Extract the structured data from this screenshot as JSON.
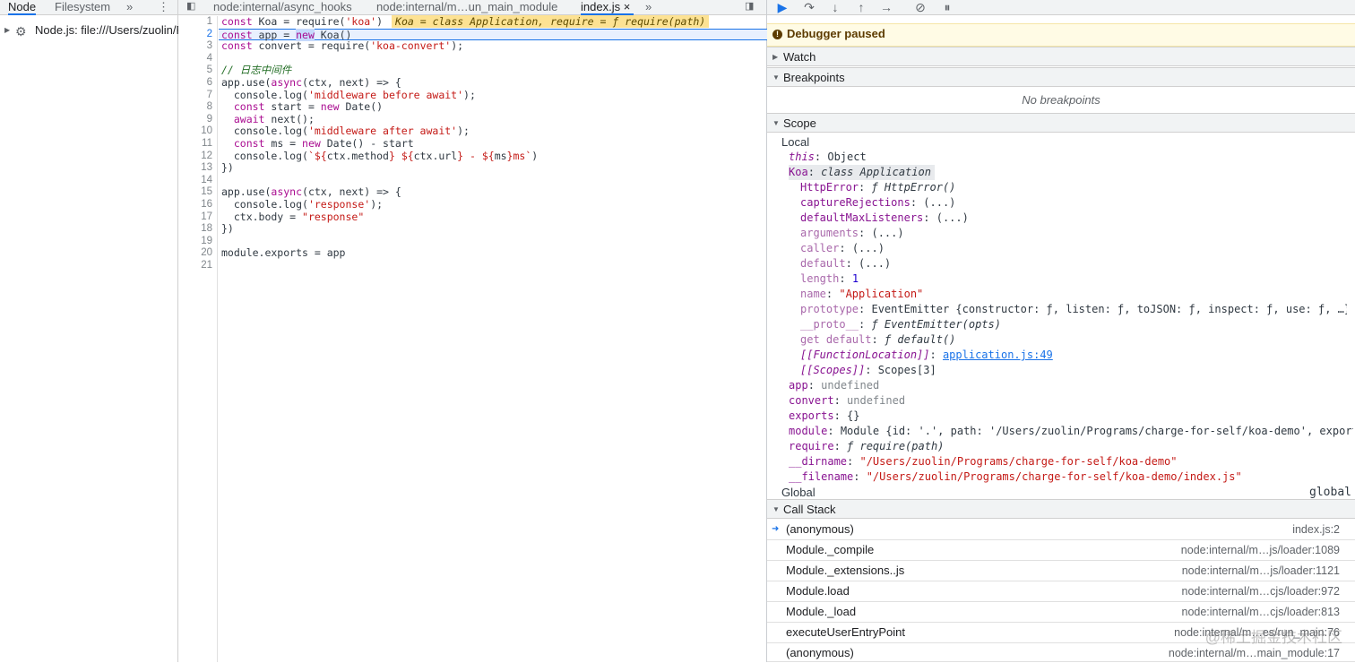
{
  "left": {
    "tabs": [
      "Node",
      "Filesystem"
    ],
    "more": "»",
    "menu": "⋮",
    "tree_item": "Node.js: file:///Users/zuolin/P"
  },
  "center": {
    "tabs": [
      "node:internal/async_hooks",
      "node:internal/m…un_main_module",
      "index.js"
    ],
    "more": "»",
    "close": "×"
  },
  "gutter": [
    "1",
    "2",
    "3",
    "4",
    "5",
    "6",
    "7",
    "8",
    "9",
    "10",
    "11",
    "12",
    "13",
    "14",
    "15",
    "16",
    "17",
    "18",
    "19",
    "20",
    "21"
  ],
  "code": {
    "inline_hint": "Koa = class Application, require = ƒ require(path)"
  },
  "debugger": {
    "paused": "Debugger paused",
    "sections": {
      "watch": "Watch",
      "breakpoints": "Breakpoints",
      "scope": "Scope",
      "call_stack": "Call Stack"
    },
    "no_breakpoints": "No breakpoints"
  },
  "scope": {
    "local": "Local",
    "global": "Global",
    "global_val": "global",
    "rows": [
      {
        "k": "this",
        "v": "Object"
      },
      {
        "k": "Koa",
        "v": "class Application"
      },
      {
        "k": "HttpError",
        "v": "ƒ HttpError()"
      },
      {
        "k": "captureRejections",
        "v": "(...)"
      },
      {
        "k": "defaultMaxListeners",
        "v": "(...)"
      },
      {
        "k": "arguments",
        "v": "(...)"
      },
      {
        "k": "caller",
        "v": "(...)"
      },
      {
        "k": "default",
        "v": "(...)"
      },
      {
        "k": "length",
        "v": "1"
      },
      {
        "k": "name",
        "v": "\"Application\""
      },
      {
        "k": "prototype",
        "v": "EventEmitter {constructor: ƒ, listen: ƒ, toJSON: ƒ, inspect: ƒ, use: ƒ, …}"
      },
      {
        "k": "__proto__",
        "v": "ƒ EventEmitter(opts)"
      },
      {
        "k": "get default",
        "v": "ƒ default()"
      },
      {
        "k": "[[FunctionLocation]]",
        "v": "application.js:49"
      },
      {
        "k": "[[Scopes]]",
        "v": "Scopes[3]"
      },
      {
        "k": "app",
        "v": "undefined"
      },
      {
        "k": "convert",
        "v": "undefined"
      },
      {
        "k": "exports",
        "v": "{}"
      },
      {
        "k": "module",
        "v": "Module {id: '.', path: '/Users/zuolin/Programs/charge-for-self/koa-demo', exports:…"
      },
      {
        "k": "require",
        "v": "ƒ require(path)"
      },
      {
        "k": "__dirname",
        "v": "\"/Users/zuolin/Programs/charge-for-self/koa-demo\""
      },
      {
        "k": "__filename",
        "v": "\"/Users/zuolin/Programs/charge-for-self/koa-demo/index.js\""
      }
    ]
  },
  "call_stack": [
    {
      "fn": "(anonymous)",
      "loc": "index.js:2"
    },
    {
      "fn": "Module._compile",
      "loc": "node:internal/m…js/loader:1089"
    },
    {
      "fn": "Module._extensions..js",
      "loc": "node:internal/m…js/loader:1121"
    },
    {
      "fn": "Module.load",
      "loc": "node:internal/m…cjs/loader:972"
    },
    {
      "fn": "Module._load",
      "loc": "node:internal/m…cjs/loader:813"
    },
    {
      "fn": "executeUserEntryPoint",
      "loc": "node:internal/m…es/run_main:76"
    },
    {
      "fn": "(anonymous)",
      "loc": "node:internal/m…main_module:17"
    }
  ],
  "watermark": "@稀土掘金技术社区"
}
